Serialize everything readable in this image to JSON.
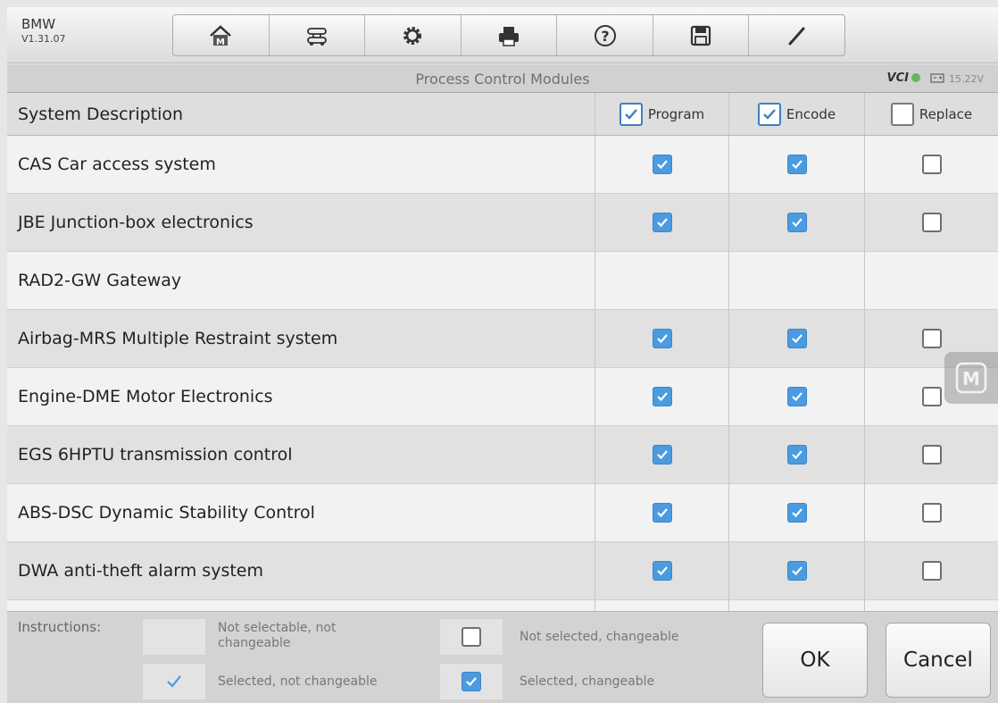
{
  "toolbar": {
    "brand": "BMW",
    "version": "V1.31.07",
    "buttons": [
      {
        "icon": "home-icon"
      },
      {
        "icon": "vehicle-swap-icon"
      },
      {
        "icon": "gear-icon"
      },
      {
        "icon": "print-icon"
      },
      {
        "icon": "help-icon"
      },
      {
        "icon": "save-icon"
      },
      {
        "icon": "pencil-icon"
      }
    ]
  },
  "titlebar": {
    "title": "Process Control Modules",
    "vci_label": "VCI",
    "voltage": "15.22V"
  },
  "table": {
    "header": {
      "description": "System Description",
      "program": "Program",
      "encode": "Encode",
      "replace": "Replace"
    },
    "rows": [
      {
        "name": "CAS Car access system",
        "program": "selected",
        "encode": "selected",
        "replace": "unselected"
      },
      {
        "name": "JBE Junction-box electronics",
        "program": "selected",
        "encode": "selected",
        "replace": "unselected"
      },
      {
        "name": "RAD2-GW Gateway",
        "program": "none",
        "encode": "none",
        "replace": "none"
      },
      {
        "name": "Airbag-MRS Multiple Restraint system",
        "program": "selected",
        "encode": "selected",
        "replace": "unselected"
      },
      {
        "name": "Engine-DME Motor Electronics",
        "program": "selected",
        "encode": "selected",
        "replace": "unselected"
      },
      {
        "name": "EGS 6HPTU transmission control",
        "program": "selected",
        "encode": "selected",
        "replace": "unselected"
      },
      {
        "name": "ABS-DSC Dynamic Stability Control",
        "program": "selected",
        "encode": "selected",
        "replace": "unselected"
      },
      {
        "name": "DWA anti-theft alarm system",
        "program": "selected",
        "encode": "selected",
        "replace": "unselected"
      }
    ]
  },
  "footer": {
    "instructions_label": "Instructions:",
    "legend": {
      "not_selectable": "Not selectable, not changeable",
      "not_selected_changeable": "Not selected, changeable",
      "selected_not_changeable": "Selected, not changeable",
      "selected_changeable": "Selected, changeable"
    },
    "ok_label": "OK",
    "cancel_label": "Cancel"
  },
  "colors": {
    "accent_blue": "#4a9be0",
    "background_frame": "#8fd2e6"
  }
}
